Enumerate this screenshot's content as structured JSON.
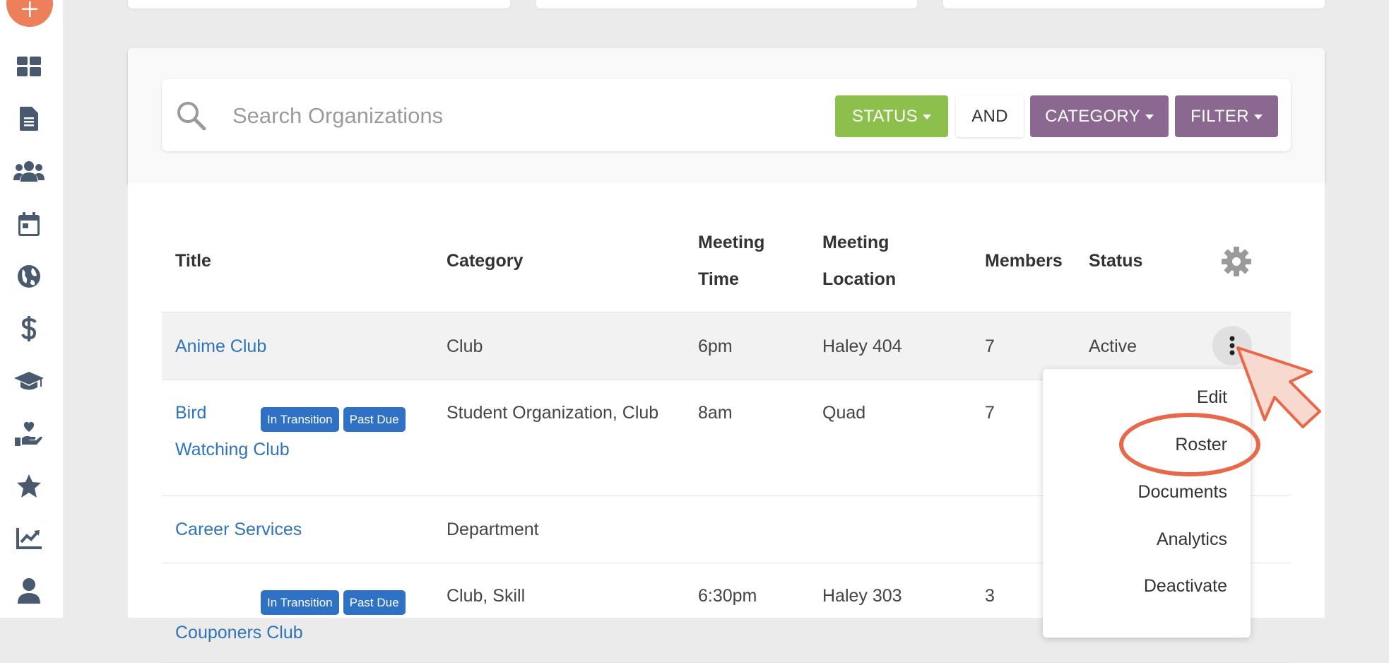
{
  "sidebar": {
    "icons": [
      "plus-icon",
      "dashboard-icon",
      "document-icon",
      "users-icon",
      "calendar-icon",
      "globe-icon",
      "dollar-icon",
      "graduation-cap-icon",
      "hand-heart-icon",
      "star-icon",
      "chart-icon",
      "user-icon"
    ]
  },
  "search": {
    "placeholder": "Search Organizations",
    "status_label": "STATUS",
    "and_label": "AND",
    "category_label": "CATEGORY",
    "filter_label": "FILTER"
  },
  "colors": {
    "status": "#8dbf4d",
    "category": "#8a6890",
    "link": "#2f73b8",
    "badge": "#2f72c5",
    "fab": "#ee7f5b",
    "highlight": "#e8684a"
  },
  "table": {
    "headers": {
      "title": "Title",
      "category": "Category",
      "meeting_time_1": "Meeting",
      "meeting_time_2": "Time",
      "meeting_location_1": "Meeting",
      "meeting_location_2": "Location",
      "members": "Members",
      "status": "Status"
    },
    "rows": [
      {
        "title": "Anime Club",
        "category": "Club",
        "time": "6pm",
        "location": "Haley 404",
        "members": "7",
        "status": "Active"
      },
      {
        "title_1": "Bird",
        "title_2": "Watching Club",
        "badge_1": "In Transition",
        "badge_2": "Past Due",
        "category": "Student Organization, Club",
        "time": "8am",
        "location": "Quad",
        "members": "7"
      },
      {
        "title": "Career Services",
        "category": "Department"
      },
      {
        "title": "Couponers Club",
        "badge_1": "In Transition",
        "badge_2": "Past Due",
        "category": "Club, Skill",
        "time": "6:30pm",
        "location": "Haley 303",
        "members": "3"
      }
    ]
  },
  "menu": {
    "items": [
      "Edit",
      "Roster",
      "Documents",
      "Analytics",
      "Deactivate"
    ]
  }
}
